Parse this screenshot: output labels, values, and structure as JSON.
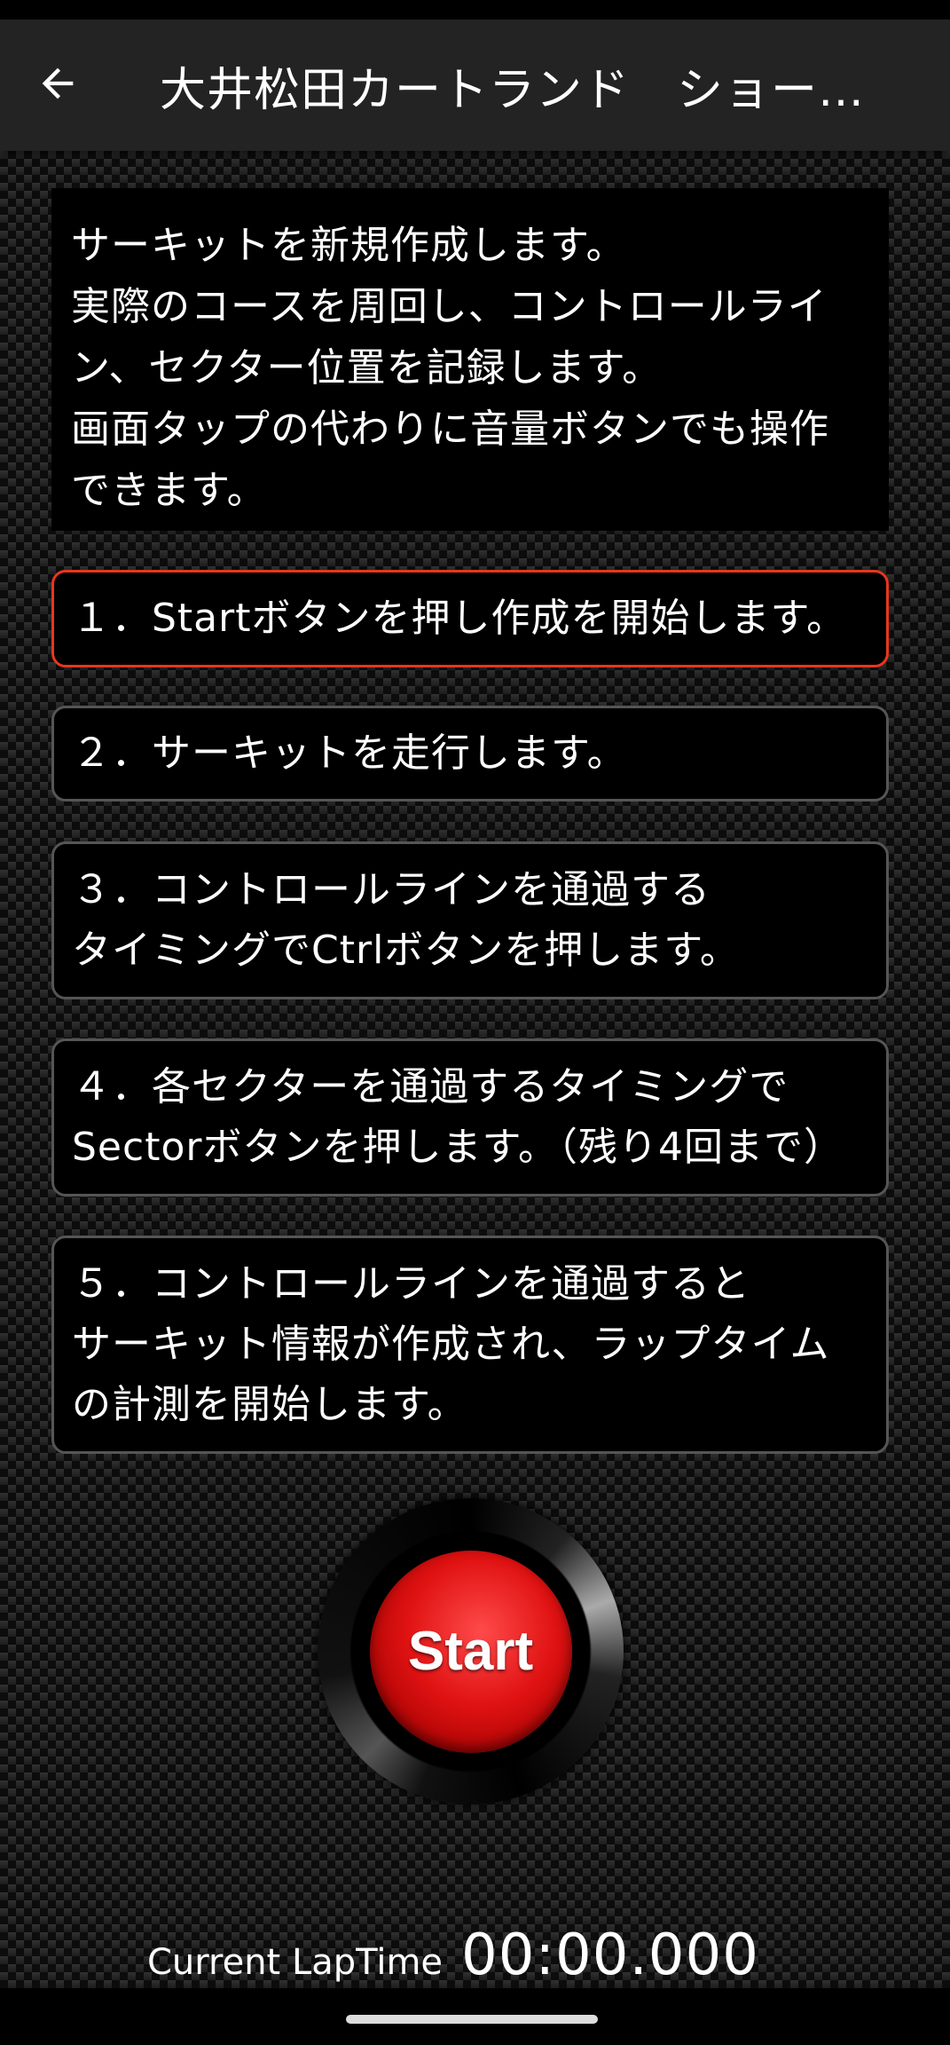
{
  "appbar": {
    "title": "大井松田カートランド　ショー…",
    "back_icon": "arrow-left-icon"
  },
  "intro": {
    "lines": [
      "サーキットを新規作成します。",
      "実際のコースを周回し、コントロールライ",
      "ン、セクター位置を記録します。",
      "画面タップの代わりに音量ボタンでも操作",
      "できます。"
    ]
  },
  "steps": [
    {
      "lines": [
        "１．Startボタンを押し作成を開始します。"
      ],
      "active": true
    },
    {
      "lines": [
        "２．サーキットを走行します。"
      ],
      "active": false
    },
    {
      "lines": [
        "３．コントロールラインを通過する",
        "タイミングでCtrlボタンを押します。"
      ],
      "active": false
    },
    {
      "lines": [
        "４．各セクターを通過するタイミングで",
        "Sectorボタンを押します。（残り4回まで）"
      ],
      "active": false
    },
    {
      "lines": [
        "５．コントロールラインを通過すると",
        "サーキット情報が作成され、ラップタイム",
        "の計測を開始します。"
      ],
      "active": false
    }
  ],
  "start_button": {
    "label": "Start"
  },
  "laptime": {
    "label": "Current LapTime",
    "value": "00:00.000"
  },
  "colors": {
    "active_border": "#e8361c",
    "start_red": "#e01212",
    "appbar_bg": "#232323"
  }
}
